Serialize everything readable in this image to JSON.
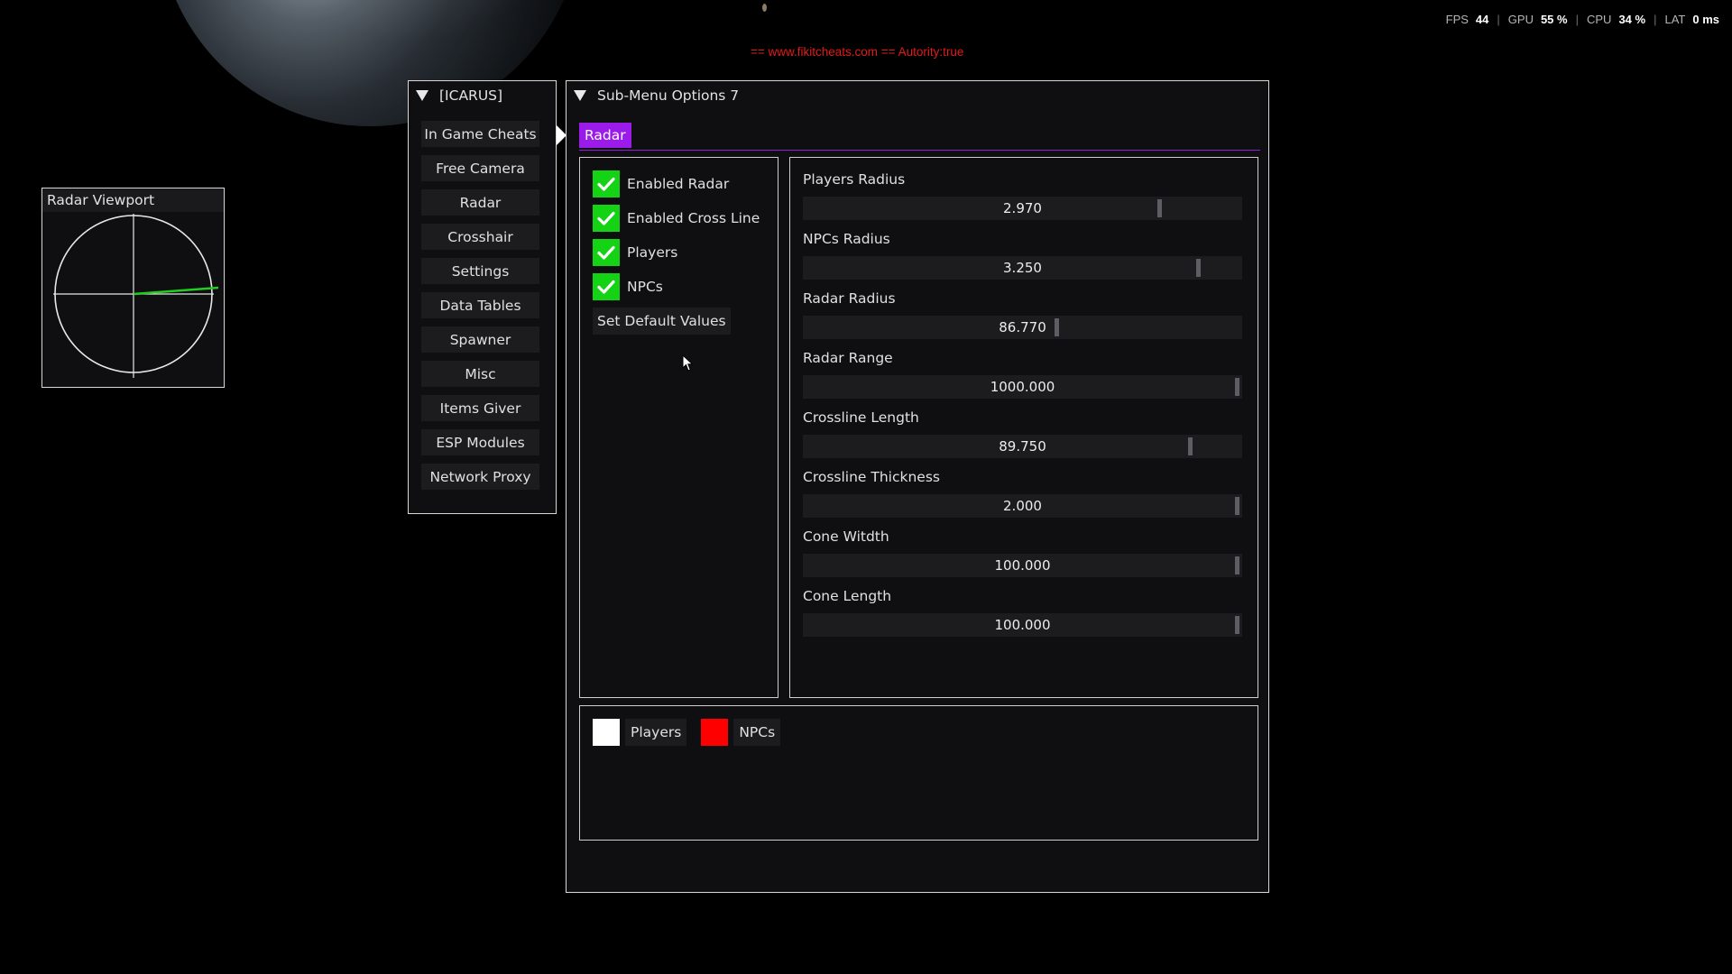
{
  "stats": {
    "fps_label": "FPS",
    "fps_value": "44",
    "gpu_label": "GPU",
    "gpu_value": "55 %",
    "cpu_label": "CPU",
    "cpu_value": "34 %",
    "lat_label": "LAT",
    "lat_value": "0 ms"
  },
  "banner": "== www.fikitcheats.com == Autority:true",
  "radar_window": {
    "title": "Radar Viewport",
    "line_color": "#22cc22"
  },
  "main_menu": {
    "title": "[ICARUS]",
    "items": [
      {
        "label": "In Game Cheats"
      },
      {
        "label": "Free Camera"
      },
      {
        "label": "Radar"
      },
      {
        "label": "Crosshair"
      },
      {
        "label": "Settings"
      },
      {
        "label": "Data Tables"
      },
      {
        "label": "Spawner"
      },
      {
        "label": "Misc"
      },
      {
        "label": "Items Giver"
      },
      {
        "label": "ESP Modules"
      },
      {
        "label": "Network Proxy"
      }
    ]
  },
  "sub_menu": {
    "title": "Sub-Menu Options 7",
    "active_tab": "Radar",
    "accent_color": "#9b1bea",
    "checkboxes": [
      {
        "label": "Enabled Radar",
        "checked": true
      },
      {
        "label": "Enabled Cross Line",
        "checked": true
      },
      {
        "label": "Players",
        "checked": true
      },
      {
        "label": "NPCs",
        "checked": true
      }
    ],
    "default_button": "Set Default Values",
    "sliders": [
      {
        "label": "Players Radius",
        "value": "2.970",
        "fraction": 0.82
      },
      {
        "label": "NPCs Radius",
        "value": "3.250",
        "fraction": 0.91
      },
      {
        "label": "Radar Radius",
        "value": "86.770",
        "fraction": 0.58
      },
      {
        "label": "Radar Range",
        "value": "1000.000",
        "fraction": 1.0
      },
      {
        "label": "Crossline Length",
        "value": "89.750",
        "fraction": 0.89
      },
      {
        "label": "Crossline Thickness",
        "value": "2.000",
        "fraction": 1.0
      },
      {
        "label": "Cone Witdth",
        "value": "100.000",
        "fraction": 1.0
      },
      {
        "label": "Cone Length",
        "value": "100.000",
        "fraction": 1.0
      }
    ],
    "colors": [
      {
        "label": "Players",
        "color": "#ffffff"
      },
      {
        "label": "NPCs",
        "color": "#ff0000"
      }
    ]
  }
}
